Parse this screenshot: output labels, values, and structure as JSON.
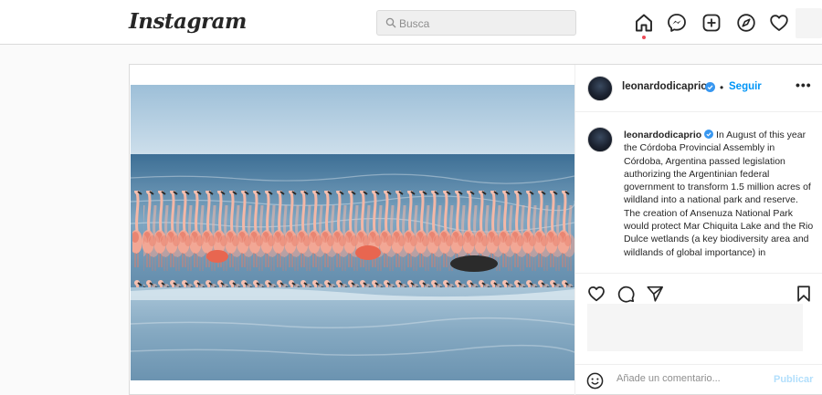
{
  "app": {
    "logo": "Instagram"
  },
  "search": {
    "placeholder": "Busca"
  },
  "nav": {
    "icons": [
      "home-icon",
      "messenger-icon",
      "new-post-icon",
      "explore-icon",
      "activity-heart-icon"
    ],
    "active": "home"
  },
  "post": {
    "author": "leonardodicaprio",
    "verified": true,
    "separator": "•",
    "follow_label": "Seguir",
    "more_label": "•••",
    "caption_user": "leonardodicaprio",
    "caption_text": "In August of this year the Córdoba Provincial Assembly in Córdoba, Argentina passed legislation authorizing the Argentinian federal government to transform 1.5 million acres of wildland into a national park and reserve. The creation of Ansenuza National Park would protect Mar Chiquita Lake and the Rio Dulce wetlands (a key biodiversity area and wildlands of global importance) in",
    "image_description": "flamingos standing in a shallow lake"
  },
  "comment": {
    "placeholder": "Añade un comentario...",
    "publish_label": "Publicar"
  },
  "colors": {
    "accent": "#0095f6",
    "publish_disabled": "#b2dffc",
    "notification_dot": "#ed4956",
    "verified_badge": "#3897f0"
  }
}
